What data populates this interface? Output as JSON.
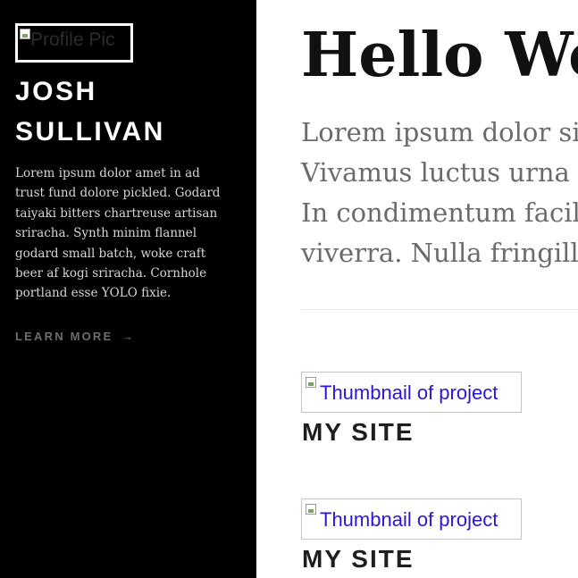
{
  "sidebar": {
    "profile_pic_alt": "Profile Pic",
    "name_first": "JOSH",
    "name_last": "SULLIVAN",
    "bio": "Lorem ipsum dolor amet in ad trust fund dolore pickled. Godard taiyaki bitters chartreuse artisan sriracha. Synth minim flannel godard small batch, woke craft beer af kogi sriracha. Cornhole portland esse YOLO fixie.",
    "learn_more": "LEARN MORE",
    "learn_more_arrow": "→"
  },
  "main": {
    "heading": "Hello World",
    "intro_lines": [
      "Lorem ipsum dolor sit amet,",
      "Vivamus luctus urna sed urna",
      "In condimentum facilisis porta.",
      "viverra. Nulla fringilla lorem."
    ],
    "projects": [
      {
        "thumbnail_alt": "Thumbnail of project",
        "title": "MY SITE"
      },
      {
        "thumbnail_alt": "Thumbnail of project",
        "title": "MY SITE"
      }
    ]
  },
  "colors": {
    "sidebar_bg": "#000000",
    "link_alt_text": "#2a16d6",
    "muted_text": "#6b6b6b"
  }
}
